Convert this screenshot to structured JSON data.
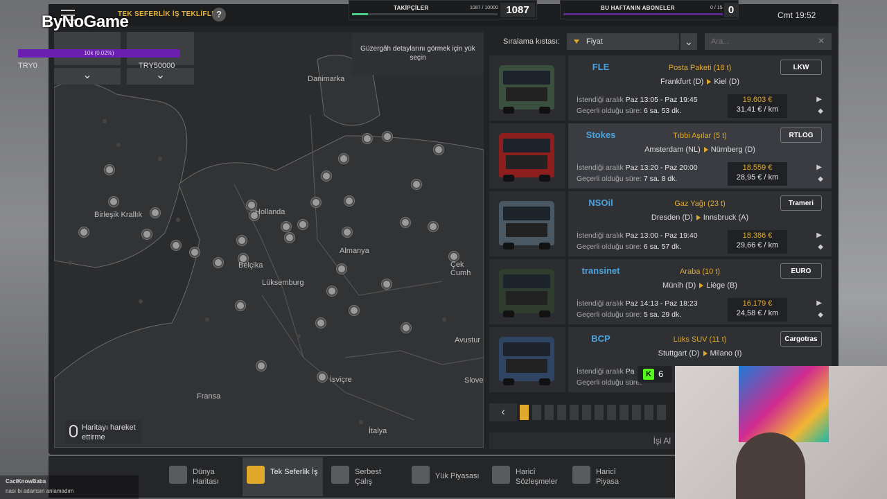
{
  "header": {
    "logo_text": "ByNoGame",
    "screen_title": "TEK SEFERLİK İŞ TEKLİFLERİ",
    "help_label": "?",
    "clock": "Cmt 19:52"
  },
  "stream": {
    "followers_label": "TAKİPÇİLER",
    "followers_progress": "1087 / 10000",
    "followers_count": "1087",
    "followers_fraction": 0.1087,
    "subs_label": "BU HAFTANIN ABONELER",
    "subs_progress": "0 / 15",
    "subs_count": "0",
    "donation_bar_text": "10k (0.02%)",
    "try_left": "TRY0",
    "try_right": "TRY50000",
    "kick_count": "6",
    "chat_user": "CaciKnowBaba",
    "chat_message": "nası bi adamsın anlamadım"
  },
  "route_tip": "Güzergâh detaylarını görmek için yük seçin",
  "sort": {
    "label": "Sıralama kıstası:",
    "selected": "Fiyat",
    "search_placeholder": "Ara..."
  },
  "jobs": [
    {
      "company": "FLE",
      "client": "LKW",
      "cargo": "Posta Paketi (18 t)",
      "from": "Frankfurt (D)",
      "to": "Kiel (D)",
      "window_label": "İstendiği aralık",
      "window": "Paz 13:05 - Paz 19:45",
      "validity_label": "Geçerli olduğu süre:",
      "validity": "6 sa. 53 dk.",
      "pay": "19.603 €",
      "per_km": "31,41 € / km",
      "truck_color": "#3b4f3e"
    },
    {
      "company": "Stokes",
      "client": "RTLOG",
      "cargo": "Tıbbi Aşılar (5 t)",
      "from": "Amsterdam (NL)",
      "to": "Nürnberg (D)",
      "window_label": "İstendiği aralık",
      "window": "Paz 13:20 - Paz 20:00",
      "validity_label": "Geçerli olduğu süre:",
      "validity": "7 sa. 8 dk.",
      "pay": "18.559 €",
      "per_km": "28,95 € / km",
      "truck_color": "#8d1e1e"
    },
    {
      "company": "NSOil",
      "client": "Trameri",
      "cargo": "Gaz Yağı (23 t)",
      "from": "Dresden (D)",
      "to": "Innsbruck (A)",
      "window_label": "İstendiği aralık",
      "window": "Paz 13:00 - Paz 19:40",
      "validity_label": "Geçerli olduğu süre:",
      "validity": "6 sa. 57 dk.",
      "pay": "18.386 €",
      "per_km": "29,66 € / km",
      "truck_color": "#4a5863"
    },
    {
      "company": "transinet",
      "client": "EURO",
      "cargo": "Araba (10 t)",
      "from": "Münih (D)",
      "to": "Liège (B)",
      "window_label": "İstendiği aralık",
      "window": "Paz 14:13 - Paz 18:23",
      "validity_label": "Geçerli olduğu süre:",
      "validity": "5 sa. 29 dk.",
      "pay": "16.179 €",
      "per_km": "24,58 € / km",
      "truck_color": "#2f3d2f"
    },
    {
      "company": "BCP",
      "client": "Cargotras",
      "cargo": "Lüks SUV (11 t)",
      "from": "Stuttgart (D)",
      "to": "Milano (I)",
      "window_label": "İstendiği aralık",
      "window": "Pa",
      "validity_label": "Geçerli olduğu süre:",
      "validity": "",
      "pay": "",
      "per_km": "",
      "truck_color": "#2f4563"
    }
  ],
  "map": {
    "labels": [
      "Danimarka",
      "Birleşik Krallık",
      "Hollanda",
      "Almanya",
      "Belçika",
      "Lüksemburg",
      "Çek Cumh",
      "Avustur",
      "İsviçre",
      "Fransa",
      "Slove",
      "İtalya"
    ],
    "move_hint": "Haritayı hareket ettirme"
  },
  "pager": {
    "is_al": "İşi Al"
  },
  "nav": [
    {
      "label": "Dünya Haritası"
    },
    {
      "label": "Tek Seferlik İş"
    },
    {
      "label": "Serbest Çalış"
    },
    {
      "label": "Yük Piyasası"
    },
    {
      "label": "Haricî Sözleşmeler"
    },
    {
      "label": "Haricî Piyasa"
    }
  ],
  "colors": {
    "accent": "#e0a92c",
    "purple": "#6a1fb0",
    "kick_green": "#53fc18"
  }
}
